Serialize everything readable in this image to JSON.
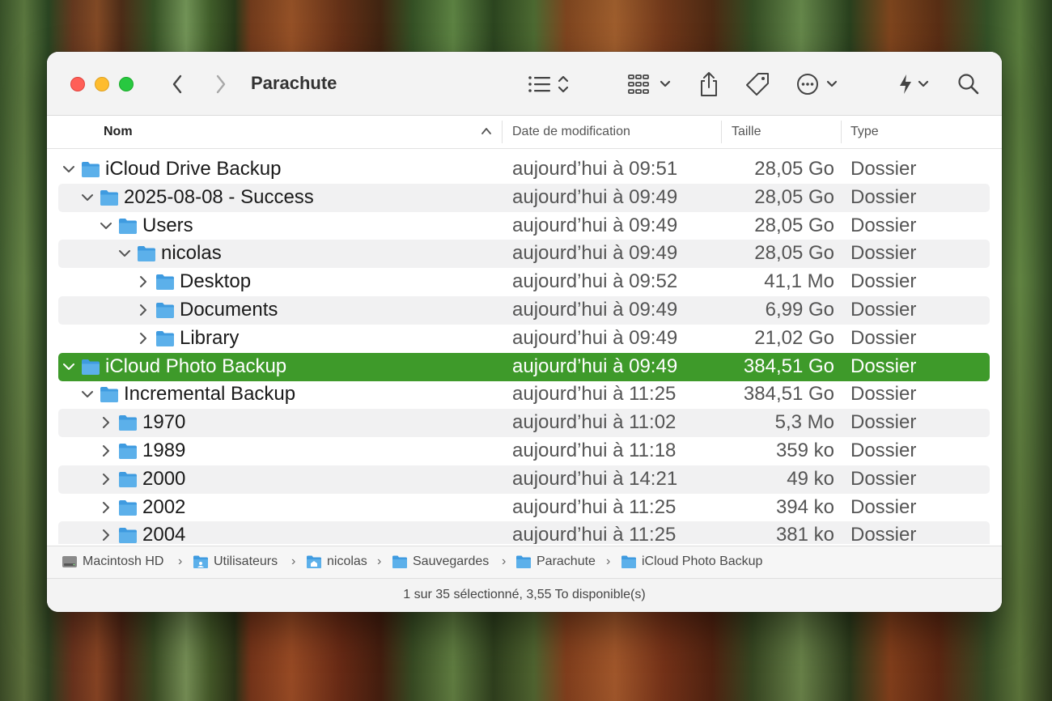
{
  "window": {
    "title": "Parachute"
  },
  "toolbar": {
    "icons": [
      "chevron-left-icon",
      "chevron-right-icon",
      "list-view-icon",
      "group-grid-icon",
      "share-icon",
      "tag-icon",
      "more-ellipsis-icon",
      "quick-action-icon",
      "search-icon"
    ]
  },
  "columns": {
    "name": "Nom",
    "date": "Date de modification",
    "size": "Taille",
    "type": "Type"
  },
  "rows": [
    {
      "name": "iCloud Drive Backup",
      "date": "aujourd’hui à 09:51",
      "size": "28,05 Go",
      "type": "Dossier",
      "level": 0,
      "expanded": true
    },
    {
      "name": "2025-08-08 - Success",
      "date": "aujourd’hui à 09:49",
      "size": "28,05 Go",
      "type": "Dossier",
      "level": 1,
      "expanded": true
    },
    {
      "name": "Users",
      "date": "aujourd’hui à 09:49",
      "size": "28,05 Go",
      "type": "Dossier",
      "level": 2,
      "expanded": true
    },
    {
      "name": "nicolas",
      "date": "aujourd’hui à 09:49",
      "size": "28,05 Go",
      "type": "Dossier",
      "level": 3,
      "expanded": true
    },
    {
      "name": "Desktop",
      "date": "aujourd’hui à 09:52",
      "size": "41,1 Mo",
      "type": "Dossier",
      "level": 4,
      "expanded": false
    },
    {
      "name": "Documents",
      "date": "aujourd’hui à 09:49",
      "size": "6,99 Go",
      "type": "Dossier",
      "level": 4,
      "expanded": false
    },
    {
      "name": "Library",
      "date": "aujourd’hui à 09:49",
      "size": "21,02 Go",
      "type": "Dossier",
      "level": 4,
      "expanded": false
    },
    {
      "name": "iCloud Photo Backup",
      "date": "aujourd’hui à 09:49",
      "size": "384,51 Go",
      "type": "Dossier",
      "level": 0,
      "expanded": true,
      "selected": true
    },
    {
      "name": "Incremental Backup",
      "date": "aujourd’hui à 11:25",
      "size": "384,51 Go",
      "type": "Dossier",
      "level": 1,
      "expanded": true
    },
    {
      "name": "1970",
      "date": "aujourd’hui à 11:02",
      "size": "5,3 Mo",
      "type": "Dossier",
      "level": 2,
      "expanded": false
    },
    {
      "name": "1989",
      "date": "aujourd’hui à 11:18",
      "size": "359 ko",
      "type": "Dossier",
      "level": 2,
      "expanded": false
    },
    {
      "name": "2000",
      "date": "aujourd’hui à 14:21",
      "size": "49 ko",
      "type": "Dossier",
      "level": 2,
      "expanded": false
    },
    {
      "name": "2002",
      "date": "aujourd’hui à 11:25",
      "size": "394 ko",
      "type": "Dossier",
      "level": 2,
      "expanded": false
    },
    {
      "name": "2004",
      "date": "aujourd’hui à 11:25",
      "size": "381 ko",
      "type": "Dossier",
      "level": 2,
      "expanded": false
    }
  ],
  "pathbar": {
    "items": [
      {
        "label": "Macintosh HD",
        "icon": "hard-drive-icon"
      },
      {
        "label": "Utilisateurs",
        "icon": "users-folder-icon"
      },
      {
        "label": "nicolas",
        "icon": "home-folder-icon"
      },
      {
        "label": "Sauvegardes",
        "icon": "folder-icon"
      },
      {
        "label": "Parachute",
        "icon": "folder-icon"
      },
      {
        "label": "iCloud Photo Backup",
        "icon": "folder-icon"
      }
    ],
    "separator": "›"
  },
  "status": {
    "text": "1 sur 35 sélectionné, 3,55 To disponible(s)"
  },
  "colors": {
    "selection": "#3e9a2a",
    "folder": "#5cb0ea"
  }
}
